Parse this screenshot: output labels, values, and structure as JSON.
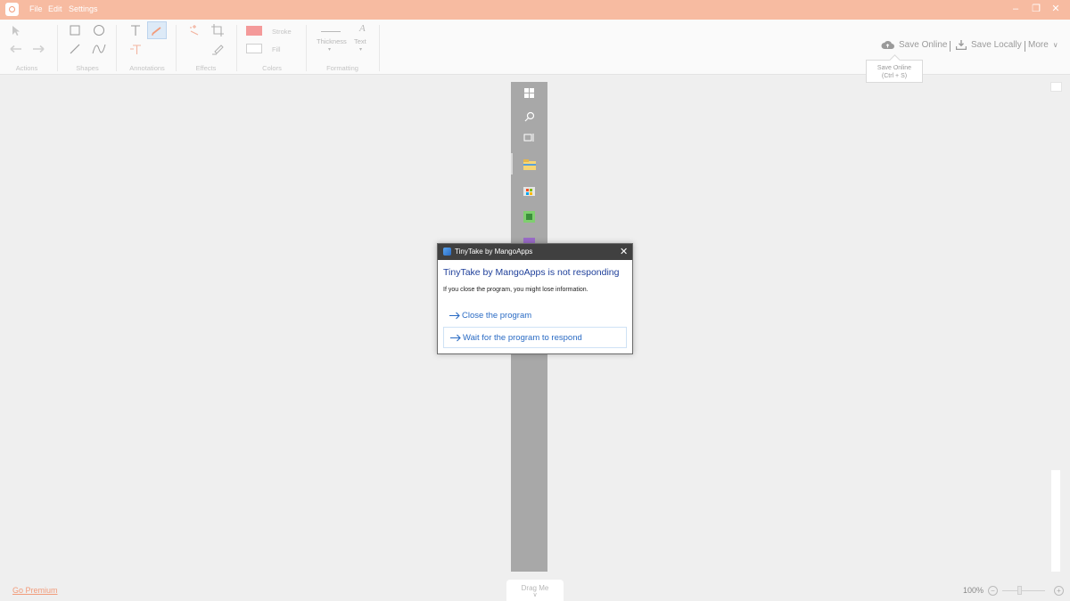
{
  "app": {
    "menu": [
      "File",
      "Edit",
      "Settings"
    ]
  },
  "ribbon": {
    "groups": {
      "actions": "Actions",
      "shapes": "Shapes",
      "annotations": "Annotations",
      "effects": "Effects",
      "colors": "Colors",
      "formatting": "Formatting"
    },
    "colors": {
      "stroke_label": "Stroke",
      "fill_label": "Fill",
      "stroke_color": "#f49a9a",
      "fill_color": "#ffffff"
    },
    "formatting": {
      "thickness_label": "Thickness",
      "text_label": "Text"
    }
  },
  "save_bar": {
    "save_online": "Save Online",
    "save_locally": "Save Locally",
    "more": "More"
  },
  "tooltip": {
    "line1": "Save Online",
    "line2": "(Ctrl + S)"
  },
  "dialog": {
    "title": "TinyTake by MangoApps",
    "heading": "TinyTake by MangoApps is not responding",
    "message": "If you close the program, you might lose information.",
    "options": [
      "Close the program",
      "Wait for the program to respond"
    ]
  },
  "footer": {
    "go_premium": "Go Premium",
    "drag_me": "Drag Me",
    "zoom": "100%"
  },
  "theme": {
    "accent": "#f7bba1",
    "link_blue": "#2a6bc4"
  }
}
